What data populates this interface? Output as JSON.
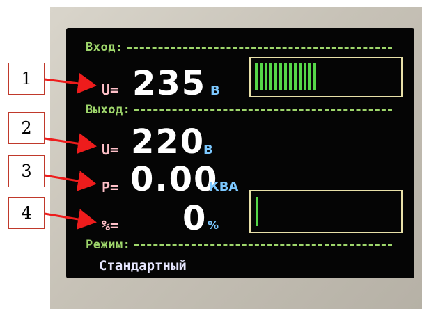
{
  "input": {
    "label": "Вход:",
    "voltage_symbol": "U=",
    "voltage_value": "235",
    "voltage_unit": "В",
    "level_fraction": 0.44
  },
  "output": {
    "label": "Выход:",
    "voltage_symbol": "U=",
    "voltage_value": "220",
    "voltage_unit": "В",
    "power_symbol": "P=",
    "power_value": "0.00",
    "power_unit": "КВА",
    "percent_symbol": "%=",
    "percent_value": "0",
    "percent_unit": "%"
  },
  "mode": {
    "label": "Режим:",
    "value": "Стандартный"
  },
  "callouts": [
    "1",
    "2",
    "3",
    "4"
  ],
  "colors": {
    "section": "#9ed66b",
    "value": "#ffffff",
    "unit": "#7cc8ff",
    "bar": "#55d648",
    "frame": "#e8e0a8",
    "arrow": "#ee1c1c"
  }
}
